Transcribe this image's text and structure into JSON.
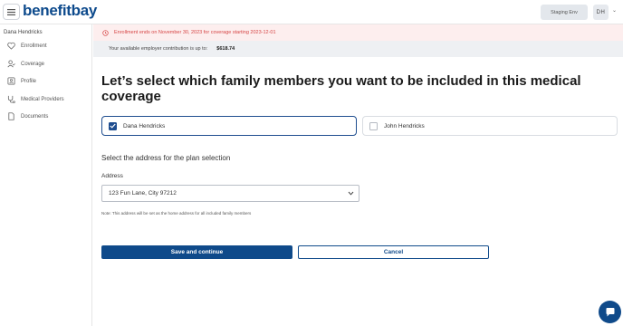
{
  "header": {
    "logo_main": "benefitbay",
    "env_label": "Staging Env",
    "avatar_initials": "DH"
  },
  "sidebar": {
    "user_name": "Dana Hendricks",
    "items": [
      {
        "label": "Enrollment",
        "icon": "heart-shield-icon"
      },
      {
        "label": "Coverage",
        "icon": "person-check-icon"
      },
      {
        "label": "Profile",
        "icon": "profile-card-icon"
      },
      {
        "label": "Medical Providers",
        "icon": "stethoscope-icon"
      },
      {
        "label": "Documents",
        "icon": "document-icon"
      }
    ]
  },
  "alert": {
    "text": "Enrollment ends on November 30, 2023 for coverage starting 2023-12-01",
    "color": "#d64545"
  },
  "contribution": {
    "label": "Your available employer contribution is up to:",
    "amount": "$618.74"
  },
  "main": {
    "heading": "Let’s select which family members you want to be included in this medical coverage",
    "members": [
      {
        "name": "Dana Hendricks",
        "checked": true
      },
      {
        "name": "John Hendricks",
        "checked": false
      }
    ],
    "address_section_title": "Select the address for the plan selection",
    "address_label": "Address",
    "address_value": "123 Fun Lane, City 97212",
    "note": "Note: This address will be set as the home address for all included family members",
    "save_button": "Save and continue",
    "cancel_button": "Cancel"
  },
  "colors": {
    "brand": "#0f4a8a",
    "alert_bg": "#fdeeee",
    "contrib_bg": "#eef0f3"
  }
}
